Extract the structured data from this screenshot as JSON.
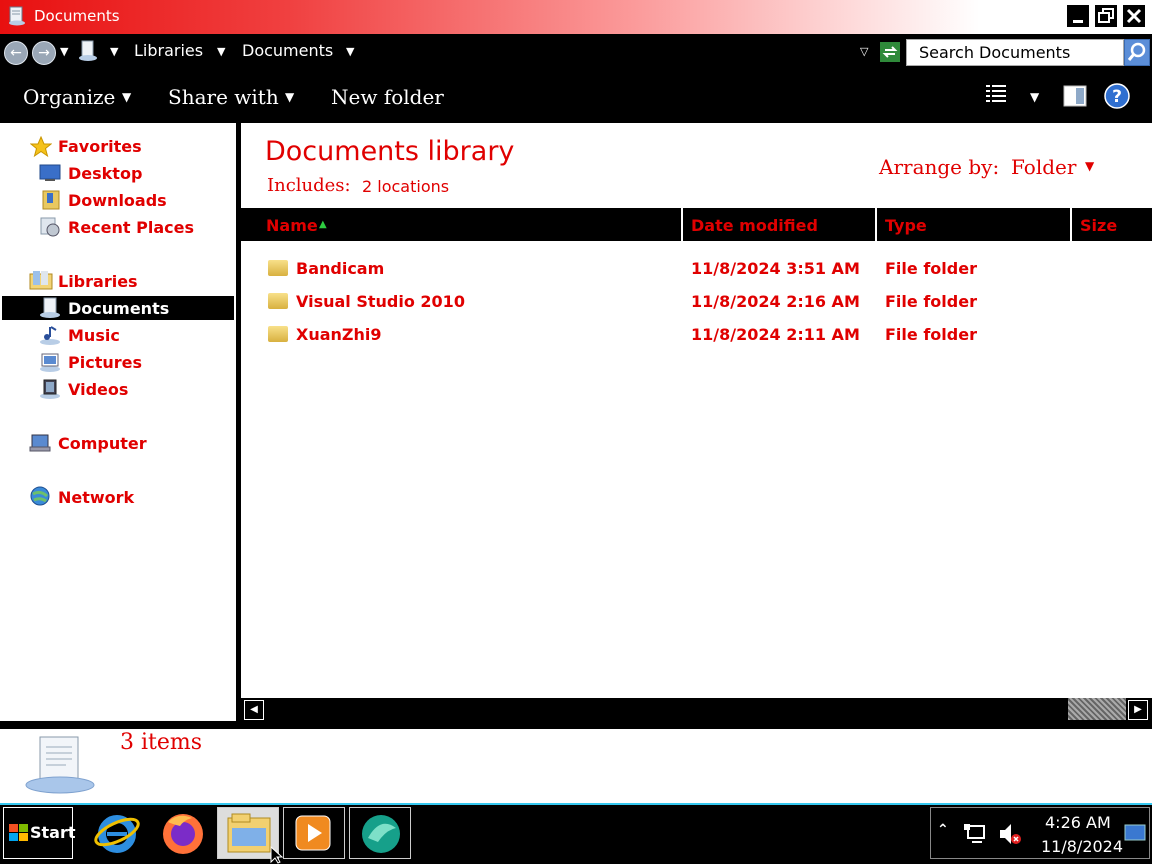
{
  "window": {
    "title": "Documents"
  },
  "address": {
    "breadcrumbs": [
      "Libraries",
      "Documents"
    ],
    "search_placeholder": "Search Documents"
  },
  "toolbar": {
    "organize": "Organize",
    "share_with": "Share with",
    "new_folder": "New folder"
  },
  "nav": {
    "favorites": "Favorites",
    "favorites_items": [
      "Desktop",
      "Downloads",
      "Recent Places"
    ],
    "libraries": "Libraries",
    "libraries_items": [
      "Documents",
      "Music",
      "Pictures",
      "Videos"
    ],
    "selected": "Documents",
    "computer": "Computer",
    "network": "Network"
  },
  "library": {
    "title": "Documents library",
    "includes_label": "Includes:",
    "includes_value": "2 locations",
    "arrange_label": "Arrange by:",
    "arrange_value": "Folder"
  },
  "columns": {
    "name": "Name",
    "date_modified": "Date modified",
    "type": "Type",
    "size": "Size"
  },
  "files": [
    {
      "name": "Bandicam",
      "date": "11/8/2024 3:51 AM",
      "type": "File folder"
    },
    {
      "name": "Visual Studio 2010",
      "date": "11/8/2024 2:16 AM",
      "type": "File folder"
    },
    {
      "name": "XuanZhi9",
      "date": "11/8/2024 2:11 AM",
      "type": "File folder"
    }
  ],
  "status": {
    "items_count": "3 items"
  },
  "taskbar": {
    "start_label": "Start",
    "apps": [
      "internet-explorer-icon",
      "firefox-icon",
      "file-explorer-icon",
      "media-player-icon",
      "app-icon"
    ],
    "time": "4:26 AM",
    "date": "11/8/2024"
  },
  "colors": {
    "accent_red": "#e00000",
    "background": "#000000",
    "taskbar_border": "#35c8f0"
  }
}
